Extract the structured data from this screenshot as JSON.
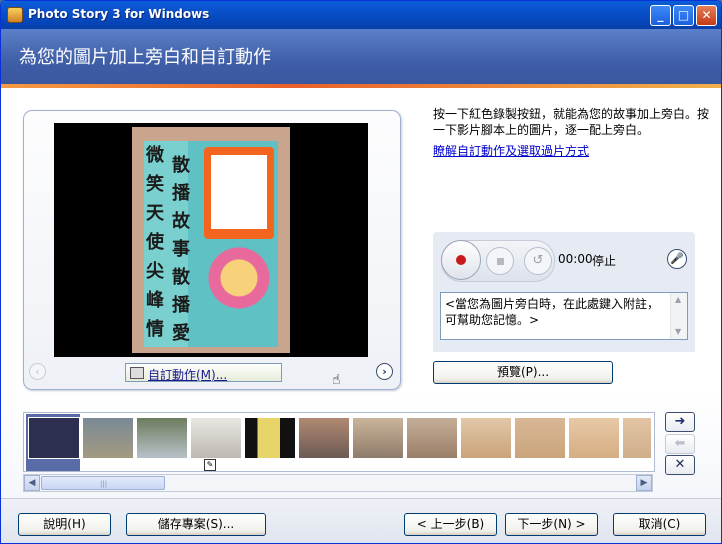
{
  "window": {
    "title": "Photo Story 3 for Windows",
    "min": "_",
    "max": "□",
    "close": "✕"
  },
  "header": {
    "title": "為您的圖片加上旁白和自訂動作"
  },
  "preview": {
    "poster_left_text": [
      "微",
      "笑",
      "天",
      "使",
      "尖",
      "峰",
      "情"
    ],
    "poster_right_text": [
      "散",
      "播",
      "故",
      "事",
      "散",
      "播",
      "愛"
    ],
    "customize_label": "自訂動作(M)...",
    "nav_left": "‹",
    "nav_right": "›"
  },
  "instructions": {
    "text": "按一下紅色錄製按鈕，就能為您的故事加上旁白。按一下影片腳本上的圖片，逐一配上旁白。",
    "link": "瞭解自訂動作及選取過片方式"
  },
  "recorder": {
    "time": "00:00",
    "status": "停止",
    "undo_icon": "↺",
    "mic_icon": "🎤",
    "notes": "<當您為圖片旁白時，在此處鍵入附註，可幫助您記憶。>",
    "preview_label": "預覽(P)..."
  },
  "filmstrip": {
    "thumb_count": 12,
    "selected_index": 0,
    "edit_mark": "✎",
    "move_right": "➜",
    "move_left": "⬅",
    "delete": "✕",
    "scroll_left": "◀",
    "scroll_right": "▶",
    "grip": "|||"
  },
  "footer": {
    "help": "說明(H)",
    "save": "儲存專案(S)...",
    "back": "< 上一步(B)",
    "next": "下一步(N) >",
    "cancel": "取消(C)"
  },
  "colors": {
    "header": "#3f5ea8",
    "accent_line": "#e8602a",
    "record_dot": "#c81a1a"
  }
}
